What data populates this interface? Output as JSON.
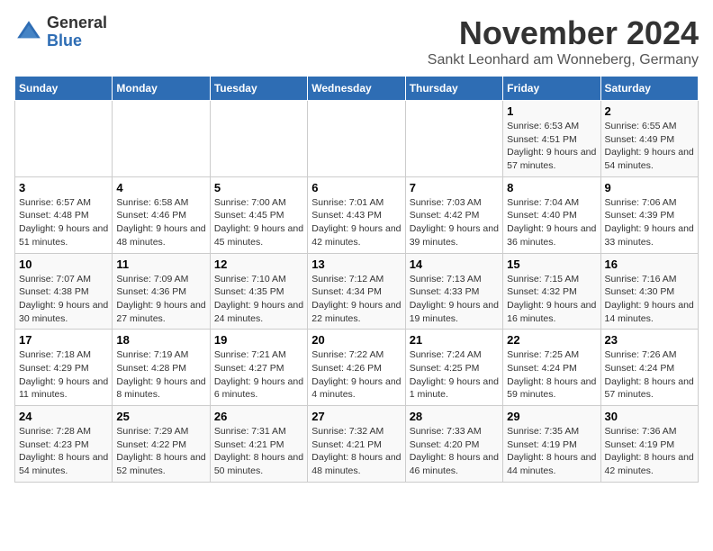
{
  "logo": {
    "general": "General",
    "blue": "Blue"
  },
  "title": "November 2024",
  "location": "Sankt Leonhard am Wonneberg, Germany",
  "days_header": [
    "Sunday",
    "Monday",
    "Tuesday",
    "Wednesday",
    "Thursday",
    "Friday",
    "Saturday"
  ],
  "weeks": [
    [
      {
        "day": "",
        "info": ""
      },
      {
        "day": "",
        "info": ""
      },
      {
        "day": "",
        "info": ""
      },
      {
        "day": "",
        "info": ""
      },
      {
        "day": "",
        "info": ""
      },
      {
        "day": "1",
        "info": "Sunrise: 6:53 AM\nSunset: 4:51 PM\nDaylight: 9 hours and 57 minutes."
      },
      {
        "day": "2",
        "info": "Sunrise: 6:55 AM\nSunset: 4:49 PM\nDaylight: 9 hours and 54 minutes."
      }
    ],
    [
      {
        "day": "3",
        "info": "Sunrise: 6:57 AM\nSunset: 4:48 PM\nDaylight: 9 hours and 51 minutes."
      },
      {
        "day": "4",
        "info": "Sunrise: 6:58 AM\nSunset: 4:46 PM\nDaylight: 9 hours and 48 minutes."
      },
      {
        "day": "5",
        "info": "Sunrise: 7:00 AM\nSunset: 4:45 PM\nDaylight: 9 hours and 45 minutes."
      },
      {
        "day": "6",
        "info": "Sunrise: 7:01 AM\nSunset: 4:43 PM\nDaylight: 9 hours and 42 minutes."
      },
      {
        "day": "7",
        "info": "Sunrise: 7:03 AM\nSunset: 4:42 PM\nDaylight: 9 hours and 39 minutes."
      },
      {
        "day": "8",
        "info": "Sunrise: 7:04 AM\nSunset: 4:40 PM\nDaylight: 9 hours and 36 minutes."
      },
      {
        "day": "9",
        "info": "Sunrise: 7:06 AM\nSunset: 4:39 PM\nDaylight: 9 hours and 33 minutes."
      }
    ],
    [
      {
        "day": "10",
        "info": "Sunrise: 7:07 AM\nSunset: 4:38 PM\nDaylight: 9 hours and 30 minutes."
      },
      {
        "day": "11",
        "info": "Sunrise: 7:09 AM\nSunset: 4:36 PM\nDaylight: 9 hours and 27 minutes."
      },
      {
        "day": "12",
        "info": "Sunrise: 7:10 AM\nSunset: 4:35 PM\nDaylight: 9 hours and 24 minutes."
      },
      {
        "day": "13",
        "info": "Sunrise: 7:12 AM\nSunset: 4:34 PM\nDaylight: 9 hours and 22 minutes."
      },
      {
        "day": "14",
        "info": "Sunrise: 7:13 AM\nSunset: 4:33 PM\nDaylight: 9 hours and 19 minutes."
      },
      {
        "day": "15",
        "info": "Sunrise: 7:15 AM\nSunset: 4:32 PM\nDaylight: 9 hours and 16 minutes."
      },
      {
        "day": "16",
        "info": "Sunrise: 7:16 AM\nSunset: 4:30 PM\nDaylight: 9 hours and 14 minutes."
      }
    ],
    [
      {
        "day": "17",
        "info": "Sunrise: 7:18 AM\nSunset: 4:29 PM\nDaylight: 9 hours and 11 minutes."
      },
      {
        "day": "18",
        "info": "Sunrise: 7:19 AM\nSunset: 4:28 PM\nDaylight: 9 hours and 8 minutes."
      },
      {
        "day": "19",
        "info": "Sunrise: 7:21 AM\nSunset: 4:27 PM\nDaylight: 9 hours and 6 minutes."
      },
      {
        "day": "20",
        "info": "Sunrise: 7:22 AM\nSunset: 4:26 PM\nDaylight: 9 hours and 4 minutes."
      },
      {
        "day": "21",
        "info": "Sunrise: 7:24 AM\nSunset: 4:25 PM\nDaylight: 9 hours and 1 minute."
      },
      {
        "day": "22",
        "info": "Sunrise: 7:25 AM\nSunset: 4:24 PM\nDaylight: 8 hours and 59 minutes."
      },
      {
        "day": "23",
        "info": "Sunrise: 7:26 AM\nSunset: 4:24 PM\nDaylight: 8 hours and 57 minutes."
      }
    ],
    [
      {
        "day": "24",
        "info": "Sunrise: 7:28 AM\nSunset: 4:23 PM\nDaylight: 8 hours and 54 minutes."
      },
      {
        "day": "25",
        "info": "Sunrise: 7:29 AM\nSunset: 4:22 PM\nDaylight: 8 hours and 52 minutes."
      },
      {
        "day": "26",
        "info": "Sunrise: 7:31 AM\nSunset: 4:21 PM\nDaylight: 8 hours and 50 minutes."
      },
      {
        "day": "27",
        "info": "Sunrise: 7:32 AM\nSunset: 4:21 PM\nDaylight: 8 hours and 48 minutes."
      },
      {
        "day": "28",
        "info": "Sunrise: 7:33 AM\nSunset: 4:20 PM\nDaylight: 8 hours and 46 minutes."
      },
      {
        "day": "29",
        "info": "Sunrise: 7:35 AM\nSunset: 4:19 PM\nDaylight: 8 hours and 44 minutes."
      },
      {
        "day": "30",
        "info": "Sunrise: 7:36 AM\nSunset: 4:19 PM\nDaylight: 8 hours and 42 minutes."
      }
    ]
  ]
}
